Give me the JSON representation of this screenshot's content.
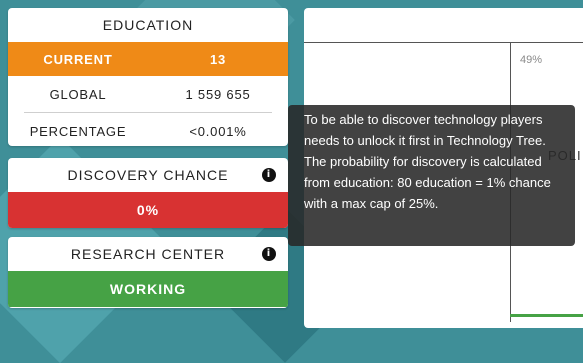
{
  "education": {
    "title": "EDUCATION",
    "rows": [
      {
        "label": "CURRENT",
        "value": "13"
      },
      {
        "label": "GLOBAL",
        "value": "1 559 655"
      },
      {
        "label": "PERCENTAGE",
        "value": "<0.001%"
      }
    ]
  },
  "discovery": {
    "title": "DISCOVERY CHANCE",
    "value": "0%",
    "info_icon": "info-circle-icon"
  },
  "research_center": {
    "title": "RESEARCH CENTER",
    "status": "WORKING",
    "info_icon": "info-circle-icon"
  },
  "panel": {
    "percent_label": "49%",
    "side_text": "POLI"
  },
  "tooltip": {
    "text": "To be able to discover technology players needs to unlock it first in Technology Tree. The probability for discovery is calculated from education: 80 education = 1% chance with a max cap of 25%."
  },
  "colors": {
    "orange": "#ef8a17",
    "red": "#d83232",
    "green": "#46a245",
    "background": "#3f8f98"
  }
}
